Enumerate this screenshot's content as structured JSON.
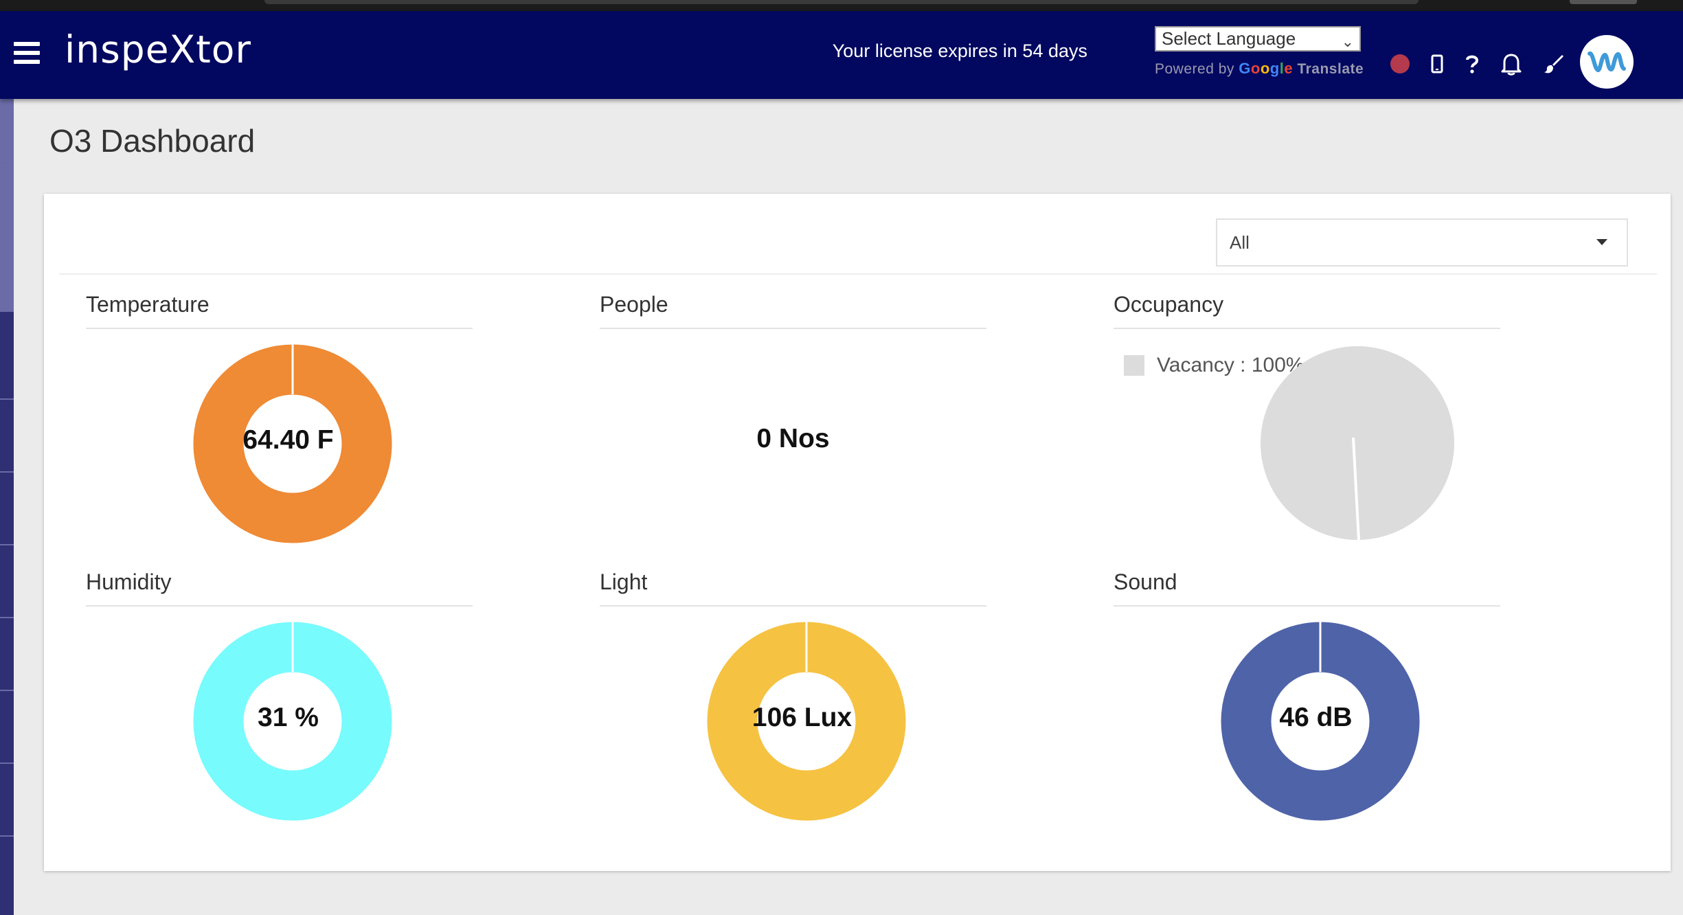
{
  "app": {
    "brand": "inspeXtor",
    "license_text": "Your license expires in 54 days"
  },
  "translate": {
    "select_label": "Select Language",
    "powered_by": "Powered by",
    "google": "Google",
    "translate_word": "Translate"
  },
  "page": {
    "title": "O3 Dashboard"
  },
  "filter": {
    "selected": "All"
  },
  "tiles": {
    "temperature": {
      "title": "Temperature",
      "value": "64.40 F",
      "color": "#ef8a35"
    },
    "people": {
      "title": "People",
      "value": "0 Nos"
    },
    "occupancy": {
      "title": "Occupancy",
      "legend": "Vacancy : 100%",
      "color": "#dcdcdc"
    },
    "humidity": {
      "title": "Humidity",
      "value": "31 %",
      "color": "#77fbfd"
    },
    "light": {
      "title": "Light",
      "value": "106 Lux",
      "color": "#f5c242"
    },
    "sound": {
      "title": "Sound",
      "value": "46 dB",
      "color": "#4f63a8"
    }
  },
  "icons": {
    "menu": "hamburger-icon",
    "record": "record-dot-icon",
    "mobile": "mobile-icon",
    "help": "question-icon",
    "notifications": "bell-icon",
    "theme": "brush-icon",
    "avatar": "company-logo-icon"
  }
}
